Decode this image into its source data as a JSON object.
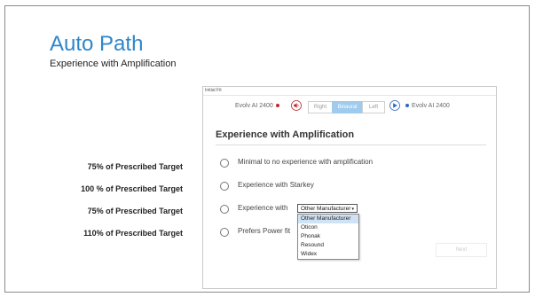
{
  "slide": {
    "title": "Auto Path",
    "subtitle": "Experience with Amplification",
    "targets": [
      "75% of Prescribed Target",
      "100 % of Prescribed Target",
      "75% of Prescribed Target",
      "110% of Prescribed Target"
    ]
  },
  "app": {
    "window_title": "Initial Fit",
    "left_device": "Evolv AI 2400",
    "right_device": "Evolv AI 2400",
    "ear_segments": [
      "Right",
      "Binaural",
      "Left"
    ],
    "active_segment": "Binaural",
    "heading": "Experience with Amplification",
    "options": [
      "Minimal to no experience with amplification",
      "Experience with Starkey",
      "Experience with",
      "Prefers Power fit"
    ],
    "manufacturer_select": {
      "value": "Other Manufacturer",
      "options": [
        "Other Manufacturer",
        "Oticon",
        "Phonak",
        "Resound",
        "Widex"
      ]
    },
    "next_label": "Next"
  },
  "colors": {
    "title": "#2e86c9",
    "left_dot": "#c0282b",
    "right_dot": "#2b67c4",
    "active_segment": "#9ecbee"
  }
}
